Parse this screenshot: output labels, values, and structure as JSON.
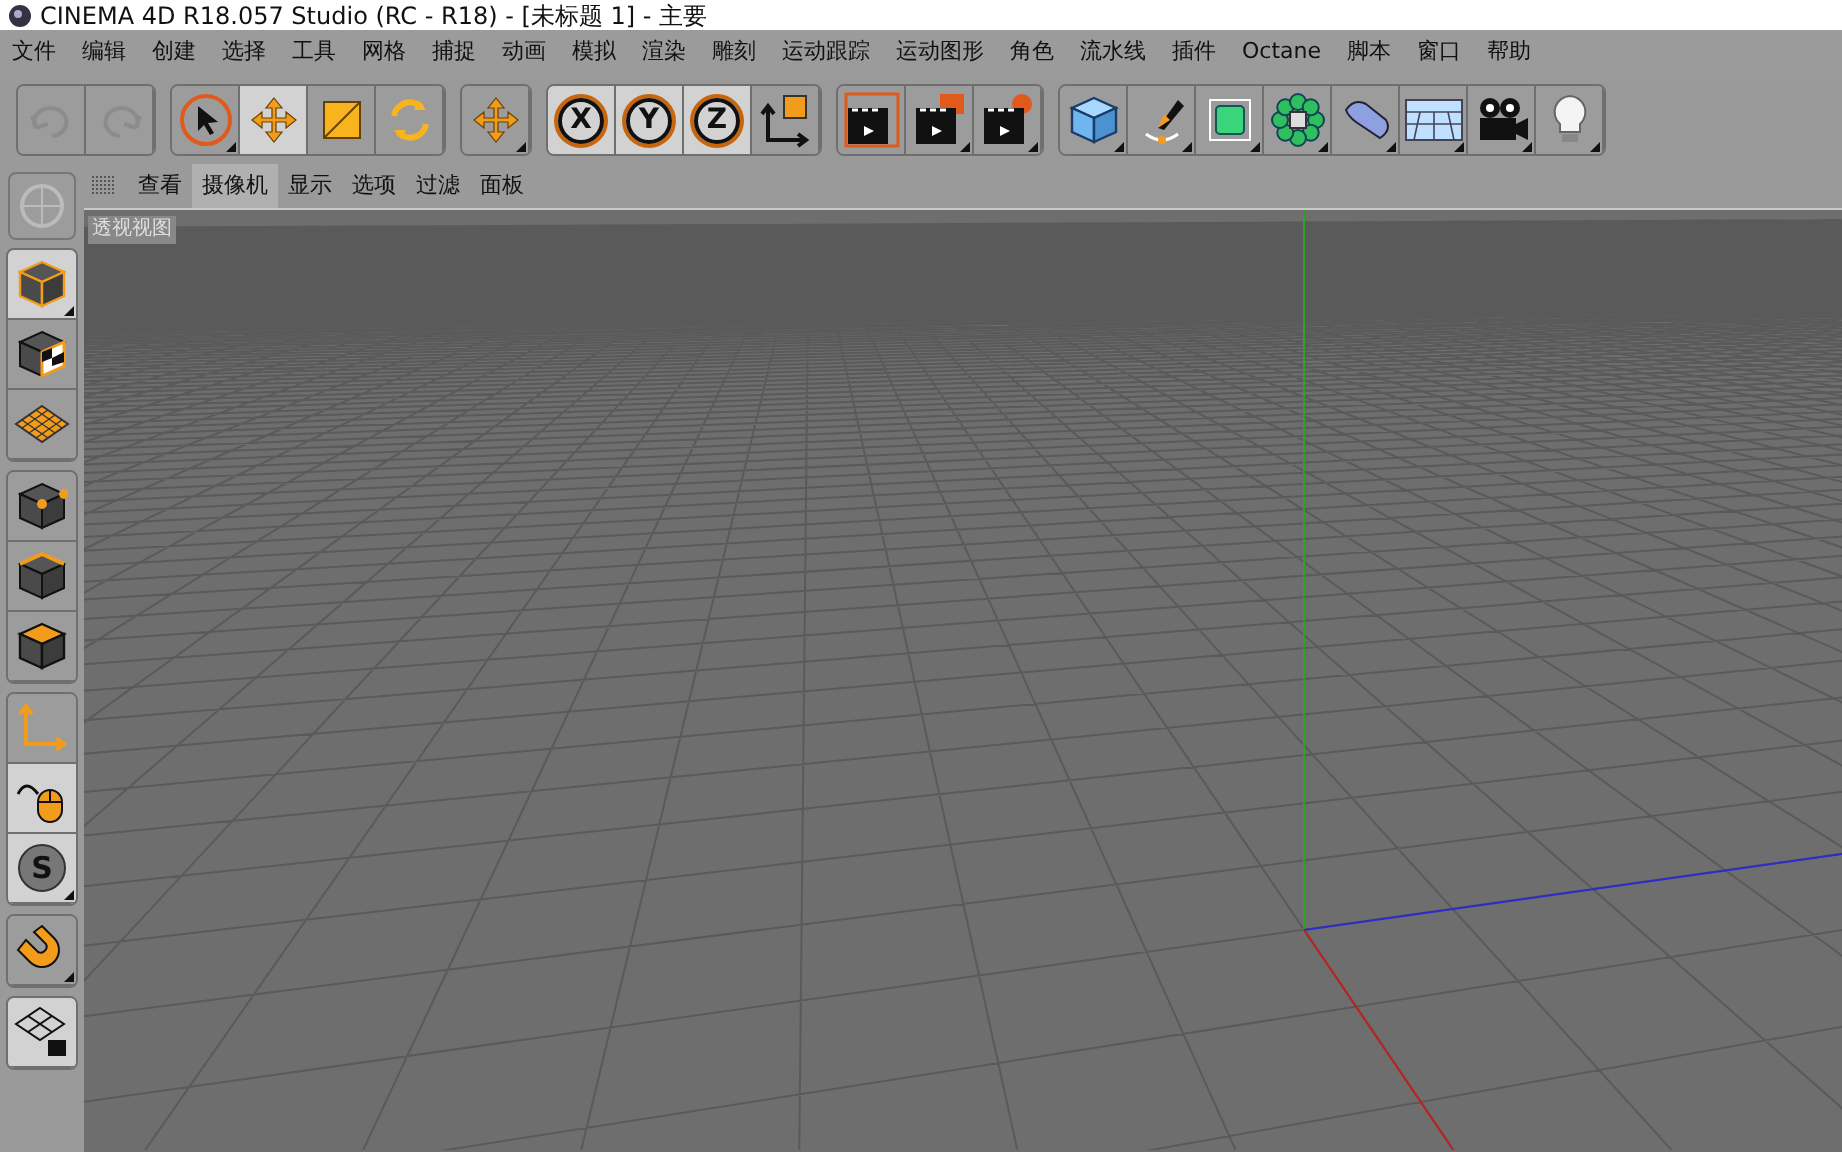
{
  "window": {
    "title": "CINEMA 4D R18.057 Studio (RC - R18) - [未标题 1] - 主要"
  },
  "menu": [
    "文件",
    "编辑",
    "创建",
    "选择",
    "工具",
    "网格",
    "捕捉",
    "动画",
    "模拟",
    "渲染",
    "雕刻",
    "运动跟踪",
    "运动图形",
    "角色",
    "流水线",
    "插件",
    "Octane",
    "脚本",
    "窗口",
    "帮助"
  ],
  "toolbar": {
    "history": [
      {
        "disabled": true
      },
      {
        "disabled": true
      }
    ],
    "tools": [
      {
        "selected": false
      },
      {
        "selected": true
      },
      {
        "selected": false
      },
      {
        "selected": false
      }
    ],
    "recent": [
      {
        "selected": false
      }
    ],
    "axes": [
      {
        "label": "X",
        "selected": true
      },
      {
        "label": "Y",
        "selected": true
      },
      {
        "label": "Z",
        "selected": true
      },
      {
        "kind": "coordinate",
        "selected": false
      }
    ],
    "render": [
      {
        "selected": false
      },
      {
        "selected": false
      },
      {
        "selected": false
      }
    ],
    "objects": [
      {
        "selected": false
      },
      {
        "selected": false
      },
      {
        "selected": false
      },
      {
        "selected": false
      },
      {
        "selected": false
      },
      {
        "selected": false
      },
      {
        "selected": false
      },
      {
        "selected": false
      }
    ]
  },
  "viewport": {
    "tabs": [
      {
        "label": "查看",
        "selected": false
      },
      {
        "label": "摄像机",
        "selected": true
      },
      {
        "label": "显示",
        "selected": false
      },
      {
        "label": "选项",
        "selected": false
      },
      {
        "label": "过滤",
        "selected": false
      },
      {
        "label": "面板",
        "selected": false
      }
    ],
    "label": "透视视图"
  },
  "left_toolbar": [
    {
      "selected": true
    },
    {
      "selected": false
    },
    {
      "selected": false
    },
    {
      "selected": false
    },
    {
      "selected": false
    },
    {
      "selected": false
    },
    {
      "selected": false
    },
    {
      "selected": true
    },
    {
      "selected": true,
      "label": "S"
    },
    {
      "selected": false
    },
    {
      "selected": true
    }
  ]
}
